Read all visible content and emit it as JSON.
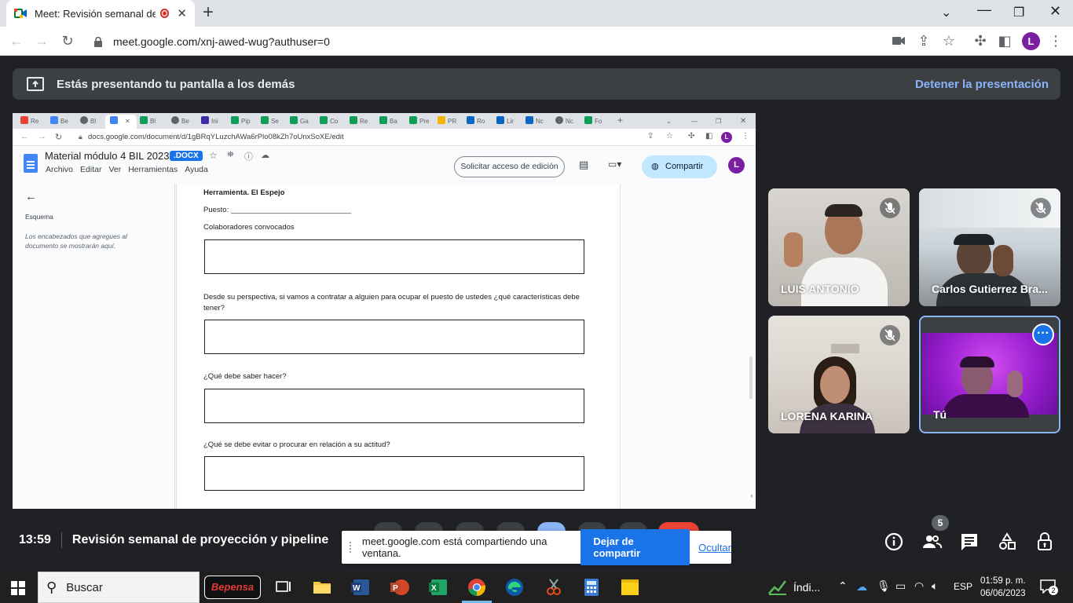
{
  "browser": {
    "tab_title": "Meet: Revisión semanal de p",
    "url": "meet.google.com/xnj-awed-wug?authuser=0",
    "profile_initial": "L"
  },
  "presenting": {
    "message": "Estás presentando tu pantalla a los demás",
    "stop_label": "Detener la presentación"
  },
  "shared": {
    "tabs": [
      "Re",
      "Be",
      "Bl",
      "",
      "Bl",
      "Be",
      "Ini",
      "Pip",
      "Se",
      "Ga",
      "Co",
      "Re",
      "Ba",
      "Pre",
      "PR",
      "Ro",
      "Lir",
      "Nc",
      "Nc",
      "Fo"
    ],
    "url": "docs.google.com/document/d/1gBRqYLuzchAWa6rPlo08kZh7oUnxSoXE/edit",
    "doc_title": "Material módulo 4 BIL 2023",
    "doc_badge": ".DOCX",
    "menu": [
      "Archivo",
      "Editar",
      "Ver",
      "Herramientas",
      "Ayuda"
    ],
    "request_edit": "Solicitar acceso de edición",
    "share": "Compartir",
    "profile_initial": "L",
    "outline_title": "Esquema",
    "outline_hint": "Los encabezados que agregues al documento se mostrarán aquí.",
    "doc": {
      "heading": "Herramienta. El Espejo",
      "puesto": "Puesto: _____________________________",
      "colaboradores": "Colaboradores convocados",
      "q1": "Desde su perspectiva, si vamos a contratar a alguien para ocupar el puesto de ustedes ¿qué características debe tener?",
      "q2": "¿Qué debe saber hacer?",
      "q3": "¿Qué se debe evitar o procurar en relación a su actitud?"
    }
  },
  "participants": [
    {
      "name": "LUIS ANTONIO",
      "muted": true
    },
    {
      "name": "Carlos Gutierrez Bra...",
      "muted": true
    },
    {
      "name": "LORENA KARINA",
      "muted": true
    },
    {
      "name": "Tú",
      "muted": false
    }
  ],
  "meeting": {
    "time": "13:59",
    "title": "Revisión semanal de proyección y pipeline",
    "people_count": "5"
  },
  "share_notification": {
    "message": "meet.google.com está compartiendo una ventana.",
    "stop_label": "Dejar de compartir",
    "hide_label": "Ocultar"
  },
  "taskbar": {
    "search_placeholder": "Buscar",
    "brand_app": "Bepensa",
    "weather_text": "Índi...",
    "lang": "ESP",
    "time": "01:59 p. m.",
    "date": "06/06/2023",
    "notifications": "2"
  },
  "colors": {
    "meet_bg": "#202124",
    "accent_blue": "#8ab4f8",
    "docs_blue": "#1a73e8",
    "avatar_purple": "#7b1fa2"
  }
}
